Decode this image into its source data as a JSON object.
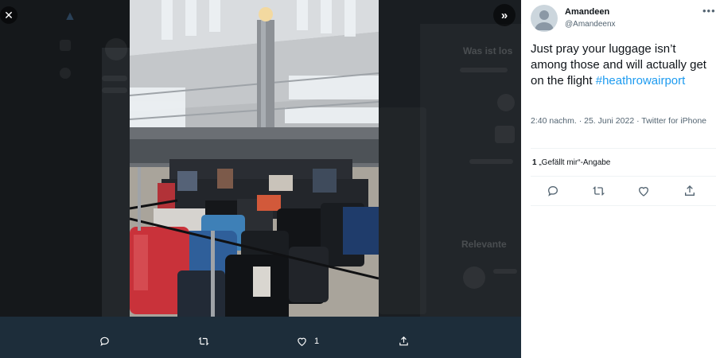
{
  "viewer": {
    "close_icon": "close-icon",
    "expand_icon": "chevron-double-right-icon"
  },
  "actions": {
    "reply_icon": "reply-icon",
    "retweet_icon": "retweet-icon",
    "like_icon": "heart-icon",
    "like_count": "1",
    "share_icon": "share-icon"
  },
  "tweet": {
    "author_name": "Amandeen",
    "author_handle": "@Amandeenx",
    "more_label": "•••",
    "text": "Just pray your luggage isn’t among those and will actually get on the flight",
    "hashtag": "#heathrowairport",
    "timestamp": "2:40 nachm. · 25. Juni 2022 · Twitter for iPhone",
    "likes_count": "1",
    "likes_label": "„Gefällt mir“-Angabe"
  },
  "background": {
    "ghost_title": "Was ist los",
    "ghost_relevant": "Relevante"
  },
  "colors": {
    "accent": "#1d9bf0",
    "panel_bg": "#ffffff",
    "action_bar": "#1d2d3a"
  }
}
